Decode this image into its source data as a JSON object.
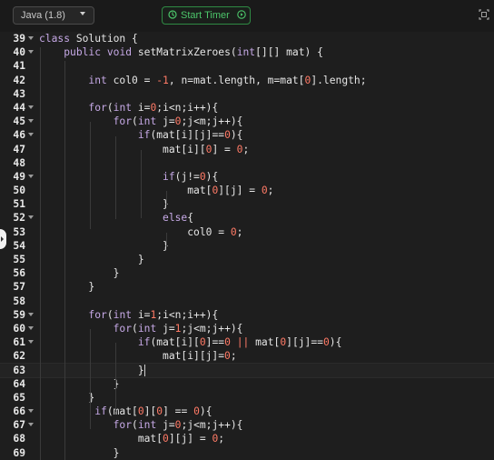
{
  "toolbar": {
    "language": "Java (1.8)",
    "timer_label": "Start Timer",
    "language_icon": "chevron-down-icon",
    "timer_icon": "clock-icon",
    "timer_play_icon": "play-icon",
    "expand_icon": "expand-icon",
    "accent": "#4cc56a"
  },
  "editor": {
    "lines": [
      {
        "n": "39",
        "fold": true,
        "tokens": [
          [
            "kw",
            "class"
          ],
          [
            "txt",
            " Solution {"
          ]
        ]
      },
      {
        "n": "40",
        "fold": true,
        "tokens": [
          [
            "txt",
            "    "
          ],
          [
            "kw",
            "public"
          ],
          [
            "txt",
            " "
          ],
          [
            "kw",
            "void"
          ],
          [
            "txt",
            " setMatrixZeroes("
          ],
          [
            "kw",
            "int"
          ],
          [
            "txt",
            "[][] mat) {"
          ]
        ]
      },
      {
        "n": "41",
        "fold": false,
        "tokens": []
      },
      {
        "n": "42",
        "fold": false,
        "tokens": [
          [
            "txt",
            "        "
          ],
          [
            "kw",
            "int"
          ],
          [
            "txt",
            " col0 = "
          ],
          [
            "num",
            "-1"
          ],
          [
            "txt",
            ", n=mat.length, m=mat["
          ],
          [
            "num",
            "0"
          ],
          [
            "txt",
            "].length;"
          ]
        ]
      },
      {
        "n": "43",
        "fold": false,
        "tokens": []
      },
      {
        "n": "44",
        "fold": true,
        "tokens": [
          [
            "txt",
            "        "
          ],
          [
            "kw",
            "for"
          ],
          [
            "txt",
            "("
          ],
          [
            "kw",
            "int"
          ],
          [
            "txt",
            " i="
          ],
          [
            "num",
            "0"
          ],
          [
            "txt",
            ";i<n;i++){"
          ]
        ]
      },
      {
        "n": "45",
        "fold": true,
        "tokens": [
          [
            "txt",
            "            "
          ],
          [
            "kw",
            "for"
          ],
          [
            "txt",
            "("
          ],
          [
            "kw",
            "int"
          ],
          [
            "txt",
            " j="
          ],
          [
            "num",
            "0"
          ],
          [
            "txt",
            ";j<m;j++){"
          ]
        ]
      },
      {
        "n": "46",
        "fold": true,
        "tokens": [
          [
            "txt",
            "                "
          ],
          [
            "kw",
            "if"
          ],
          [
            "txt",
            "(mat[i][j]=="
          ],
          [
            "num",
            "0"
          ],
          [
            "txt",
            "){"
          ]
        ]
      },
      {
        "n": "47",
        "fold": false,
        "tokens": [
          [
            "txt",
            "                    mat[i]["
          ],
          [
            "num",
            "0"
          ],
          [
            "txt",
            "] = "
          ],
          [
            "num",
            "0"
          ],
          [
            "txt",
            ";"
          ]
        ]
      },
      {
        "n": "48",
        "fold": false,
        "tokens": []
      },
      {
        "n": "49",
        "fold": true,
        "tokens": [
          [
            "txt",
            "                    "
          ],
          [
            "kw",
            "if"
          ],
          [
            "txt",
            "(j!="
          ],
          [
            "num",
            "0"
          ],
          [
            "txt",
            "){"
          ]
        ]
      },
      {
        "n": "50",
        "fold": false,
        "tokens": [
          [
            "txt",
            "                        mat["
          ],
          [
            "num",
            "0"
          ],
          [
            "txt",
            "][j] = "
          ],
          [
            "num",
            "0"
          ],
          [
            "txt",
            ";"
          ]
        ]
      },
      {
        "n": "51",
        "fold": false,
        "tokens": [
          [
            "txt",
            "                    }"
          ]
        ]
      },
      {
        "n": "52",
        "fold": true,
        "tokens": [
          [
            "txt",
            "                    "
          ],
          [
            "kw",
            "else"
          ],
          [
            "txt",
            "{"
          ]
        ]
      },
      {
        "n": "53",
        "fold": false,
        "tokens": [
          [
            "txt",
            "                        col0 = "
          ],
          [
            "num",
            "0"
          ],
          [
            "txt",
            ";"
          ]
        ]
      },
      {
        "n": "54",
        "fold": false,
        "tokens": [
          [
            "txt",
            "                    }"
          ]
        ]
      },
      {
        "n": "55",
        "fold": false,
        "tokens": [
          [
            "txt",
            "                }"
          ]
        ]
      },
      {
        "n": "56",
        "fold": false,
        "tokens": [
          [
            "txt",
            "            }"
          ]
        ]
      },
      {
        "n": "57",
        "fold": false,
        "tokens": [
          [
            "txt",
            "        }"
          ]
        ]
      },
      {
        "n": "58",
        "fold": false,
        "tokens": []
      },
      {
        "n": "59",
        "fold": true,
        "tokens": [
          [
            "txt",
            "        "
          ],
          [
            "kw",
            "for"
          ],
          [
            "txt",
            "("
          ],
          [
            "kw",
            "int"
          ],
          [
            "txt",
            " i="
          ],
          [
            "num",
            "1"
          ],
          [
            "txt",
            ";i<n;i++){"
          ]
        ]
      },
      {
        "n": "60",
        "fold": true,
        "tokens": [
          [
            "txt",
            "            "
          ],
          [
            "kw",
            "for"
          ],
          [
            "txt",
            "("
          ],
          [
            "kw",
            "int"
          ],
          [
            "txt",
            " j="
          ],
          [
            "num",
            "1"
          ],
          [
            "txt",
            ";j<m;j++){"
          ]
        ]
      },
      {
        "n": "61",
        "fold": true,
        "tokens": [
          [
            "txt",
            "                "
          ],
          [
            "kw",
            "if"
          ],
          [
            "txt",
            "(mat[i]["
          ],
          [
            "num",
            "0"
          ],
          [
            "txt",
            "]=="
          ],
          [
            "num",
            "0"
          ],
          [
            "txt",
            " "
          ],
          [
            "num",
            "||"
          ],
          [
            "txt",
            " mat["
          ],
          [
            "num",
            "0"
          ],
          [
            "txt",
            "][j]=="
          ],
          [
            "num",
            "0"
          ],
          [
            "txt",
            "){"
          ]
        ]
      },
      {
        "n": "62",
        "fold": false,
        "tokens": [
          [
            "txt",
            "                    mat[i][j]="
          ],
          [
            "num",
            "0"
          ],
          [
            "txt",
            ";"
          ]
        ]
      },
      {
        "n": "63",
        "fold": false,
        "active": true,
        "tokens": [
          [
            "txt",
            "                }"
          ]
        ]
      },
      {
        "n": "64",
        "fold": false,
        "tokens": [
          [
            "txt",
            "            }"
          ]
        ]
      },
      {
        "n": "65",
        "fold": false,
        "tokens": [
          [
            "txt",
            "        }"
          ]
        ]
      },
      {
        "n": "66",
        "fold": true,
        "tokens": [
          [
            "txt",
            "         "
          ],
          [
            "kw",
            "if"
          ],
          [
            "txt",
            "(mat["
          ],
          [
            "num",
            "0"
          ],
          [
            "txt",
            "]["
          ],
          [
            "num",
            "0"
          ],
          [
            "txt",
            "] == "
          ],
          [
            "num",
            "0"
          ],
          [
            "txt",
            "){"
          ]
        ]
      },
      {
        "n": "67",
        "fold": true,
        "tokens": [
          [
            "txt",
            "            "
          ],
          [
            "kw",
            "for"
          ],
          [
            "txt",
            "("
          ],
          [
            "kw",
            "int"
          ],
          [
            "txt",
            " j="
          ],
          [
            "num",
            "0"
          ],
          [
            "txt",
            ";j<m;j++){"
          ]
        ]
      },
      {
        "n": "68",
        "fold": false,
        "tokens": [
          [
            "txt",
            "                mat["
          ],
          [
            "num",
            "0"
          ],
          [
            "txt",
            "][j] = "
          ],
          [
            "num",
            "0"
          ],
          [
            "txt",
            ";"
          ]
        ]
      },
      {
        "n": "69",
        "fold": false,
        "tokens": [
          [
            "txt",
            "            }"
          ]
        ]
      }
    ]
  }
}
